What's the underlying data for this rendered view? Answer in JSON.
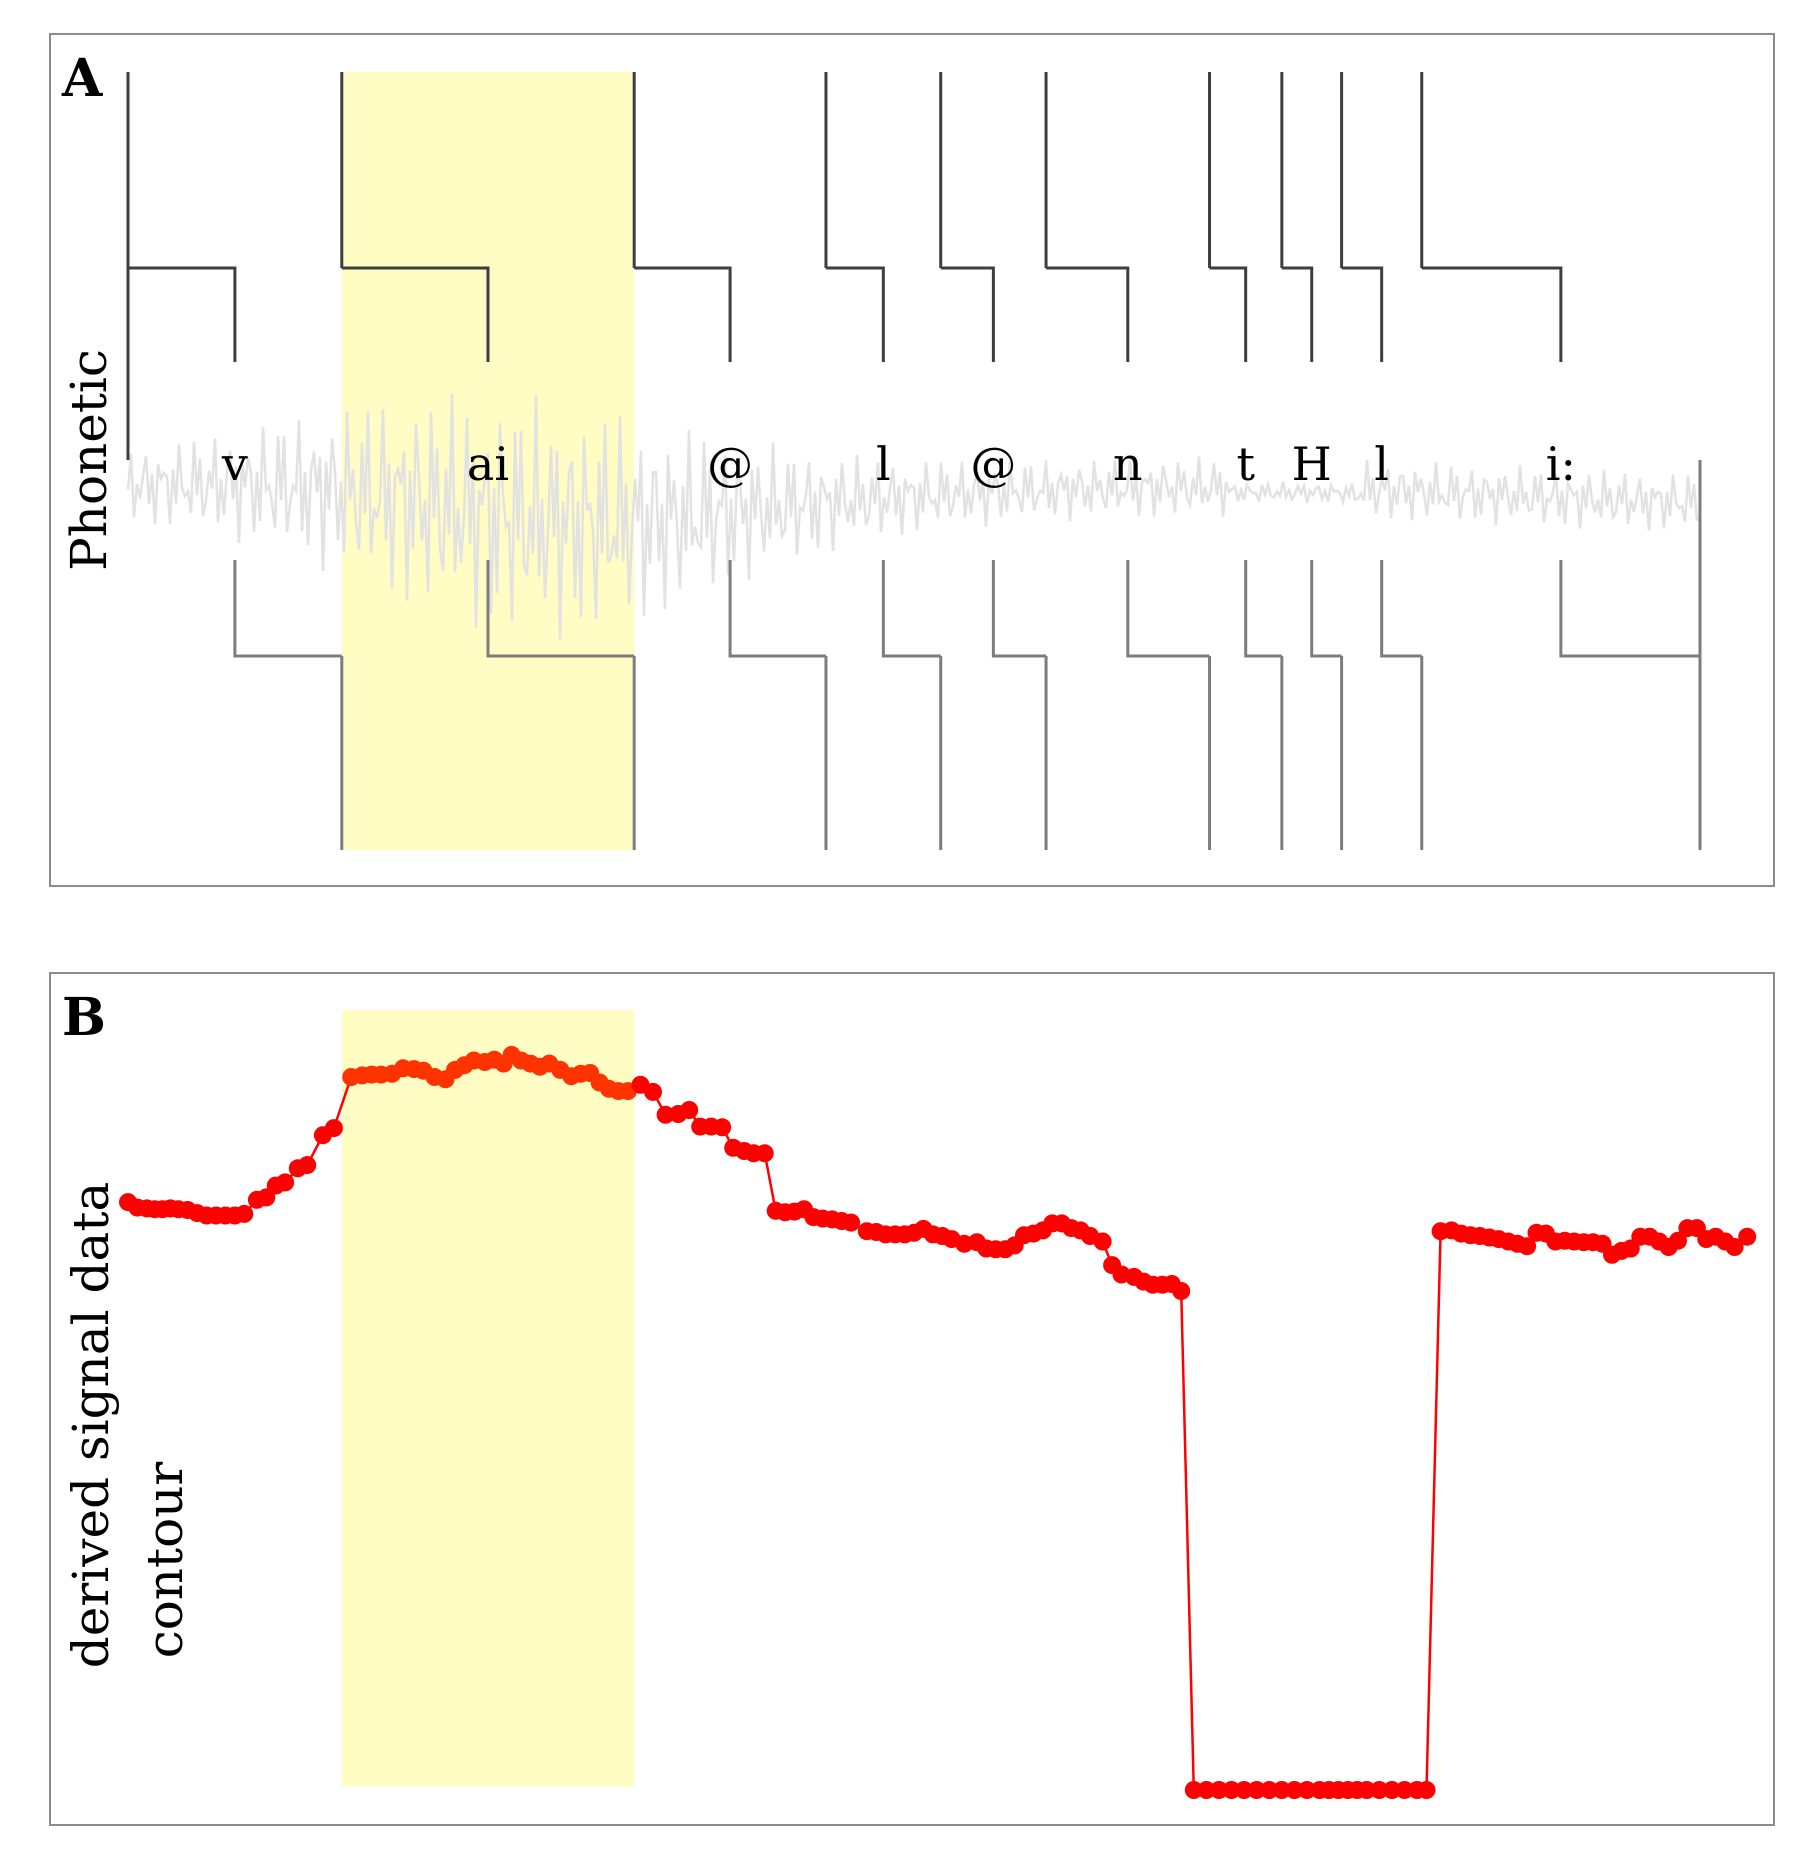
{
  "panels": {
    "a": {
      "letter": "A",
      "ylabel": "Phonetic"
    },
    "b": {
      "letter": "B",
      "ylabel_line1": "derived signal data",
      "ylabel_line2": "contour"
    }
  },
  "colors": {
    "highlight": "#fffcc4",
    "contour": "#ff0000",
    "contour_highlighted": "#ff3300",
    "waveform": "#e2e2e2",
    "boundary_top": "#3d3d44",
    "boundary_bottom": "#7d7d7d"
  },
  "chart_data": [
    {
      "type": "segmentation",
      "panel": "A",
      "xlim": [
        0,
        1
      ],
      "boundaries": [
        0.0,
        0.136,
        0.322,
        0.444,
        0.517,
        0.584,
        0.688,
        0.734,
        0.772,
        0.823,
        1.0
      ],
      "segments": [
        {
          "label": "v",
          "start": 0.0,
          "end": 0.136
        },
        {
          "label": "ai",
          "start": 0.136,
          "end": 0.322
        },
        {
          "label": "@",
          "start": 0.322,
          "end": 0.444
        },
        {
          "label": "l",
          "start": 0.444,
          "end": 0.517
        },
        {
          "label": "@",
          "start": 0.517,
          "end": 0.584
        },
        {
          "label": "n",
          "start": 0.584,
          "end": 0.688
        },
        {
          "label": "t",
          "start": 0.688,
          "end": 0.734
        },
        {
          "label": "H",
          "start": 0.734,
          "end": 0.772
        },
        {
          "label": "l",
          "start": 0.772,
          "end": 0.823
        },
        {
          "label": "i:",
          "start": 0.823,
          "end": 1.0
        }
      ],
      "highlight": {
        "start": 0.136,
        "end": 0.322
      }
    },
    {
      "type": "line",
      "panel": "B",
      "xlim": [
        0,
        1
      ],
      "ylim": [
        0,
        1
      ],
      "grid": false,
      "highlight": {
        "start": 0.136,
        "end": 0.322
      },
      "points": [
        [
          0.0,
          0.747
        ],
        [
          0.006,
          0.74
        ],
        [
          0.012,
          0.739
        ],
        [
          0.017,
          0.738
        ],
        [
          0.022,
          0.738
        ],
        [
          0.027,
          0.739
        ],
        [
          0.032,
          0.738
        ],
        [
          0.038,
          0.737
        ],
        [
          0.044,
          0.733
        ],
        [
          0.05,
          0.73
        ],
        [
          0.056,
          0.73
        ],
        [
          0.062,
          0.73
        ],
        [
          0.068,
          0.73
        ],
        [
          0.074,
          0.732
        ],
        [
          0.082,
          0.75
        ],
        [
          0.088,
          0.753
        ],
        [
          0.094,
          0.768
        ],
        [
          0.1,
          0.772
        ],
        [
          0.108,
          0.79
        ],
        [
          0.114,
          0.794
        ],
        [
          0.124,
          0.832
        ],
        [
          0.131,
          0.841
        ],
        [
          0.142,
          0.906
        ],
        [
          0.149,
          0.908
        ],
        [
          0.155,
          0.909
        ],
        [
          0.161,
          0.909
        ],
        [
          0.168,
          0.91
        ],
        [
          0.175,
          0.917
        ],
        [
          0.182,
          0.916
        ],
        [
          0.188,
          0.914
        ],
        [
          0.195,
          0.906
        ],
        [
          0.202,
          0.903
        ],
        [
          0.208,
          0.915
        ],
        [
          0.214,
          0.921
        ],
        [
          0.22,
          0.927
        ],
        [
          0.227,
          0.925
        ],
        [
          0.233,
          0.928
        ],
        [
          0.239,
          0.923
        ],
        [
          0.244,
          0.934
        ],
        [
          0.25,
          0.927
        ],
        [
          0.256,
          0.923
        ],
        [
          0.262,
          0.919
        ],
        [
          0.268,
          0.923
        ],
        [
          0.275,
          0.915
        ],
        [
          0.282,
          0.907
        ],
        [
          0.288,
          0.91
        ],
        [
          0.294,
          0.911
        ],
        [
          0.3,
          0.899
        ],
        [
          0.306,
          0.891
        ],
        [
          0.312,
          0.888
        ],
        [
          0.318,
          0.888
        ],
        [
          0.326,
          0.896
        ],
        [
          0.334,
          0.887
        ],
        [
          0.342,
          0.858
        ],
        [
          0.35,
          0.859
        ],
        [
          0.357,
          0.864
        ],
        [
          0.364,
          0.843
        ],
        [
          0.371,
          0.843
        ],
        [
          0.378,
          0.842
        ],
        [
          0.385,
          0.816
        ],
        [
          0.392,
          0.812
        ],
        [
          0.398,
          0.809
        ],
        [
          0.405,
          0.809
        ],
        [
          0.412,
          0.736
        ],
        [
          0.418,
          0.734
        ],
        [
          0.424,
          0.735
        ],
        [
          0.43,
          0.738
        ],
        [
          0.436,
          0.728
        ],
        [
          0.442,
          0.726
        ],
        [
          0.448,
          0.725
        ],
        [
          0.454,
          0.723
        ],
        [
          0.46,
          0.721
        ],
        [
          0.47,
          0.71
        ],
        [
          0.476,
          0.709
        ],
        [
          0.482,
          0.706
        ],
        [
          0.488,
          0.706
        ],
        [
          0.494,
          0.706
        ],
        [
          0.5,
          0.708
        ],
        [
          0.506,
          0.713
        ],
        [
          0.512,
          0.706
        ],
        [
          0.518,
          0.704
        ],
        [
          0.524,
          0.7
        ],
        [
          0.532,
          0.694
        ],
        [
          0.54,
          0.696
        ],
        [
          0.546,
          0.688
        ],
        [
          0.552,
          0.687
        ],
        [
          0.558,
          0.687
        ],
        [
          0.564,
          0.692
        ],
        [
          0.57,
          0.705
        ],
        [
          0.576,
          0.707
        ],
        [
          0.582,
          0.711
        ],
        [
          0.588,
          0.72
        ],
        [
          0.594,
          0.72
        ],
        [
          0.6,
          0.714
        ],
        [
          0.606,
          0.711
        ],
        [
          0.612,
          0.704
        ],
        [
          0.62,
          0.697
        ],
        [
          0.626,
          0.667
        ],
        [
          0.632,
          0.655
        ],
        [
          0.64,
          0.652
        ],
        [
          0.646,
          0.646
        ],
        [
          0.652,
          0.642
        ],
        [
          0.658,
          0.642
        ],
        [
          0.664,
          0.643
        ],
        [
          0.67,
          0.634
        ],
        [
          0.678,
          0.0
        ],
        [
          0.686,
          0.0
        ],
        [
          0.694,
          0.0
        ],
        [
          0.702,
          0.0
        ],
        [
          0.71,
          0.0
        ],
        [
          0.718,
          0.0
        ],
        [
          0.726,
          0.0
        ],
        [
          0.734,
          0.0
        ],
        [
          0.742,
          0.0
        ],
        [
          0.75,
          0.0
        ],
        [
          0.758,
          0.0
        ],
        [
          0.764,
          0.0
        ],
        [
          0.77,
          0.0
        ],
        [
          0.776,
          0.0
        ],
        [
          0.782,
          0.0
        ],
        [
          0.788,
          0.0
        ],
        [
          0.796,
          0.0
        ],
        [
          0.804,
          0.0
        ],
        [
          0.812,
          0.0
        ],
        [
          0.82,
          0.0
        ],
        [
          0.826,
          0.0
        ],
        [
          0.835,
          0.71
        ],
        [
          0.842,
          0.711
        ],
        [
          0.848,
          0.707
        ],
        [
          0.854,
          0.705
        ],
        [
          0.86,
          0.704
        ],
        [
          0.866,
          0.702
        ],
        [
          0.872,
          0.7
        ],
        [
          0.878,
          0.697
        ],
        [
          0.884,
          0.694
        ],
        [
          0.89,
          0.691
        ],
        [
          0.896,
          0.708
        ],
        [
          0.902,
          0.707
        ],
        [
          0.908,
          0.697
        ],
        [
          0.914,
          0.698
        ],
        [
          0.92,
          0.697
        ],
        [
          0.926,
          0.696
        ],
        [
          0.932,
          0.696
        ],
        [
          0.938,
          0.694
        ],
        [
          0.944,
          0.68
        ],
        [
          0.95,
          0.685
        ],
        [
          0.956,
          0.688
        ],
        [
          0.962,
          0.703
        ],
        [
          0.968,
          0.703
        ],
        [
          0.974,
          0.697
        ],
        [
          0.98,
          0.69
        ],
        [
          0.986,
          0.698
        ],
        [
          0.992,
          0.714
        ],
        [
          0.998,
          0.714
        ],
        [
          1.004,
          0.7
        ],
        [
          1.01,
          0.703
        ],
        [
          1.016,
          0.697
        ],
        [
          1.022,
          0.69
        ],
        [
          1.03,
          0.703
        ]
      ]
    }
  ]
}
